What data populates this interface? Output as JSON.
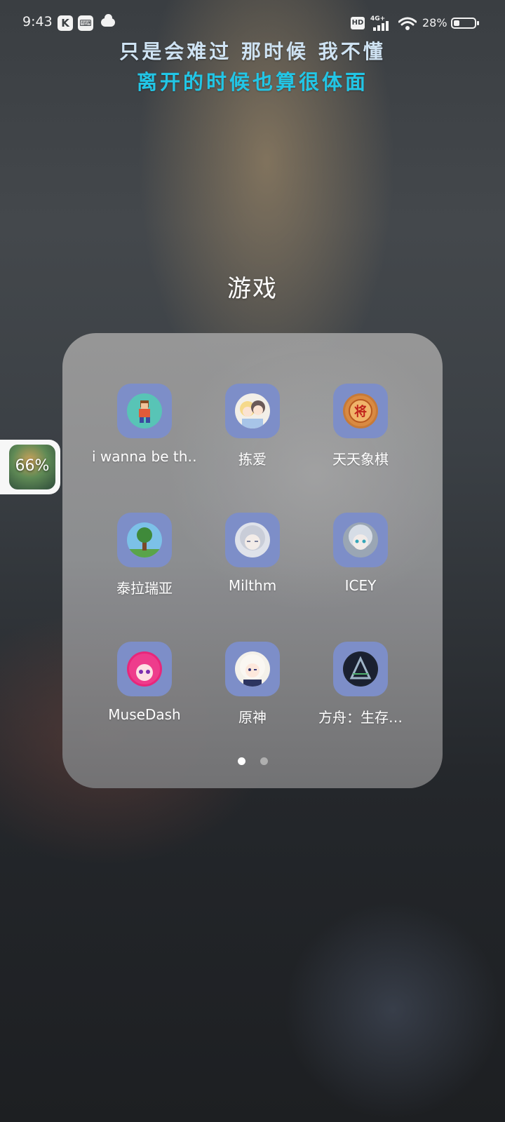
{
  "status_bar": {
    "time": "9:43",
    "network_type": "4G+",
    "hd_label": "HD",
    "battery_percent_text": "28%",
    "battery_level": 0.28
  },
  "lyrics": {
    "line1": "只是会难过 那时候 我不懂",
    "line2": "离开的时候也算很体面"
  },
  "folder": {
    "title": "游戏",
    "apps": [
      {
        "label": "i wanna be th…",
        "icon": "pixel-hero-icon"
      },
      {
        "label": "拣爱",
        "icon": "anime-couple-icon"
      },
      {
        "label": "天天象棋",
        "icon": "chinese-chess-icon"
      },
      {
        "label": "泰拉瑞亚",
        "icon": "terraria-tree-icon"
      },
      {
        "label": "Milthm",
        "icon": "anime-girl-silver-icon"
      },
      {
        "label": "ICEY",
        "icon": "icey-girl-icon"
      },
      {
        "label": "MuseDash",
        "icon": "musedash-girl-icon"
      },
      {
        "label": "原神",
        "icon": "paimon-icon"
      },
      {
        "label": "方舟：生存…",
        "icon": "ark-survival-icon"
      }
    ],
    "pages": 2,
    "current_page": 1
  },
  "floating_badge": {
    "text": "66%"
  },
  "colors": {
    "tile": "#7d8ec8",
    "lyric1": "#cfe3f3",
    "lyric2": "#22c6e6"
  }
}
